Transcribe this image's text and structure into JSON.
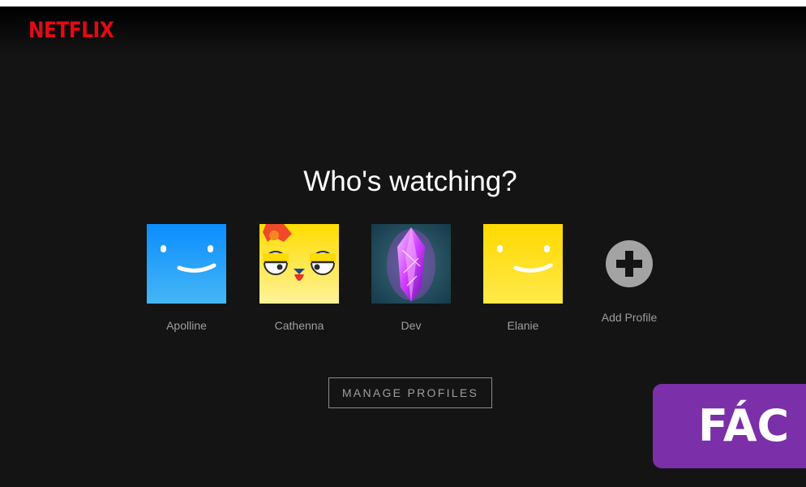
{
  "header": {
    "logo_text": "NETFLIX",
    "brand_color": "#e50914"
  },
  "main": {
    "title": "Who's watching?",
    "profiles": [
      {
        "name": "Apolline",
        "avatar_icon": "blue-smile-avatar",
        "color": "#1e90ff"
      },
      {
        "name": "Cathenna",
        "avatar_icon": "yellow-chicken-avatar",
        "color": "#ffe100"
      },
      {
        "name": "Dev",
        "avatar_icon": "purple-crystal-avatar",
        "color": "#8a2be2"
      },
      {
        "name": "Elanie",
        "avatar_icon": "yellow-smile-avatar",
        "color": "#ffd400"
      }
    ],
    "add_profile": {
      "label": "Add Profile",
      "icon": "plus-circle-icon"
    },
    "manage_profiles_label": "MANAGE PROFILES"
  },
  "watermark": {
    "text": "FÁC",
    "color": "#7b2fa8"
  }
}
